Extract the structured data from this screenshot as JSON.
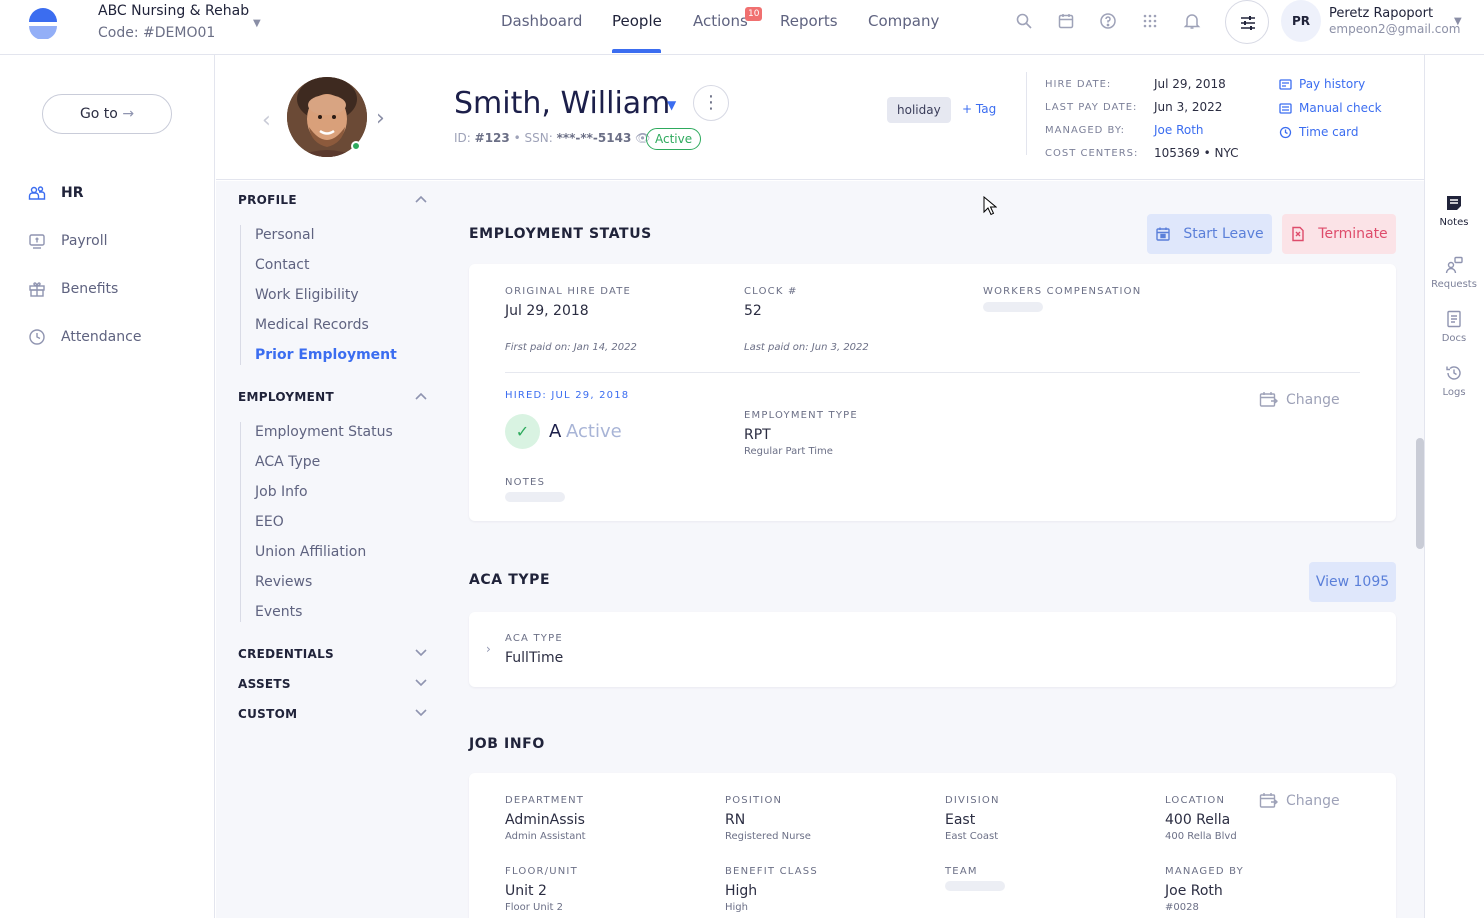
{
  "company": {
    "name": "ABC Nursing & Rehab",
    "code": "Code: #DEMO01"
  },
  "nav": {
    "items": [
      "Dashboard",
      "People",
      "Actions",
      "Reports",
      "Company"
    ],
    "active": "People",
    "actions_badge": "10"
  },
  "user": {
    "initials": "PR",
    "name": "Peretz Rapoport",
    "email": "empeon2@gmail.com"
  },
  "leftnav": {
    "goto_label": "Go to",
    "items": [
      "HR",
      "Payroll",
      "Benefits",
      "Attendance"
    ],
    "active": "HR"
  },
  "employee": {
    "name": "Smith, William",
    "id_label": "ID:",
    "id": "#123",
    "ssn_label": "SSN:",
    "ssn": "***-**-5143",
    "status": "Active",
    "tag": "holiday",
    "add_tag": "+ Tag"
  },
  "meta": {
    "hire_date_label": "HIRE DATE:",
    "hire_date": "Jul 29, 2018",
    "last_pay_label": "LAST PAY DATE:",
    "last_pay": "Jun 3, 2022",
    "managed_by_label": "MANAGED BY:",
    "managed_by": "Joe Roth",
    "cost_centers_label": "COST CENTERS:",
    "cost_centers": "105369 • NYC"
  },
  "quick_links": [
    "Pay history",
    "Manual check",
    "Time card"
  ],
  "rightrail": [
    "Notes",
    "Requests",
    "Docs",
    "Logs"
  ],
  "sections": {
    "profile": {
      "title": "PROFILE",
      "items": [
        "Personal",
        "Contact",
        "Work Eligibility",
        "Medical Records",
        "Prior Employment"
      ],
      "active": "Prior Employment"
    },
    "employment": {
      "title": "EMPLOYMENT",
      "items": [
        "Employment Status",
        "ACA Type",
        "Job Info",
        "EEO",
        "Union Affiliation",
        "Reviews",
        "Events"
      ]
    },
    "credentials": {
      "title": "CREDENTIALS"
    },
    "assets": {
      "title": "ASSETS"
    },
    "custom": {
      "title": "CUSTOM"
    }
  },
  "employment_status": {
    "title": "EMPLOYMENT STATUS",
    "start_leave": "Start Leave",
    "terminate": "Terminate",
    "original_hire_date_label": "ORIGINAL HIRE DATE",
    "original_hire_date": "Jul 29, 2018",
    "first_paid": "First paid on: Jan 14, 2022",
    "clock_label": "CLOCK #",
    "clock": "52",
    "last_paid": "Last paid on: Jun 3, 2022",
    "workers_comp_label": "WORKERS COMPENSATION",
    "hired_label": "HIRED: JUL 29, 2018",
    "status_code": "A",
    "status_text": "Active",
    "employment_type_label": "EMPLOYMENT TYPE",
    "employment_type": "RPT",
    "employment_type_sub": "Regular Part Time",
    "notes_label": "NOTES",
    "change": "Change"
  },
  "aca": {
    "title": "ACA TYPE",
    "view_1095": "View 1095",
    "label": "ACA TYPE",
    "value": "FullTime"
  },
  "job_info": {
    "title": "JOB INFO",
    "change": "Change",
    "fields": [
      {
        "label": "DEPARTMENT",
        "value": "AdminAssis",
        "sub": "Admin Assistant"
      },
      {
        "label": "POSITION",
        "value": "RN",
        "sub": "Registered Nurse"
      },
      {
        "label": "DIVISION",
        "value": "East",
        "sub": "East Coast"
      },
      {
        "label": "LOCATION",
        "value": "400 Rella",
        "sub": "400 Rella Blvd"
      },
      {
        "label": "FLOOR/UNIT",
        "value": "Unit 2",
        "sub": "Floor Unit 2"
      },
      {
        "label": "BENEFIT CLASS",
        "value": "High",
        "sub": "High"
      },
      {
        "label": "TEAM",
        "value": "",
        "sub": ""
      },
      {
        "label": "MANAGED BY",
        "value": "Joe Roth",
        "sub": "#0028"
      }
    ]
  },
  "colors": {
    "accent": "#3b6df0",
    "success": "#2eaa5d",
    "danger": "#de4c6b",
    "badge": "#f07070"
  }
}
